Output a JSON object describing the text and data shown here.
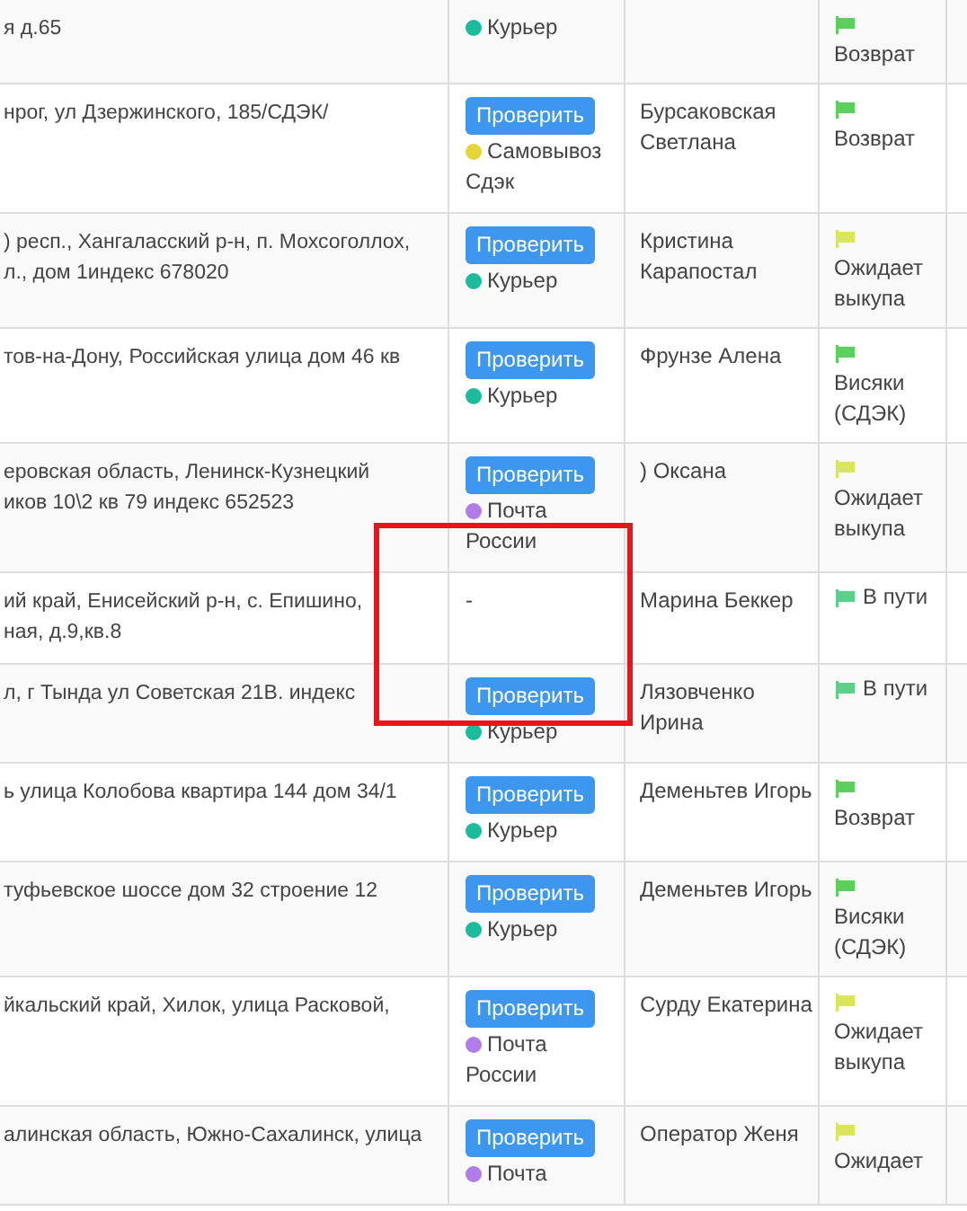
{
  "rows": [
    {
      "address": [
        "я д.65"
      ],
      "check_button": null,
      "delivery": {
        "label": "Курьер",
        "color": "#1abc9c"
      },
      "recipient": null,
      "status": {
        "label": "Возврат",
        "color": "#5ccf5c"
      }
    },
    {
      "address": [
        "нрог, ул Дзержинского, 185/СДЭК/"
      ],
      "check_button": "Проверить",
      "delivery": {
        "label": "Самовывоз Сдэк",
        "color": "#e6d536"
      },
      "recipient": "Бурсаковская Светлана",
      "status": {
        "label": "Возврат",
        "color": "#5ccf5c"
      }
    },
    {
      "address": [
        ") респ., Хангаласский р-н, п. Мохсоголлох,",
        "л., дом 1индекс 678020"
      ],
      "check_button": "Проверить",
      "delivery": {
        "label": "Курьер",
        "color": "#1abc9c"
      },
      "recipient": "Кристина Карапостал",
      "status": {
        "label": "Ожидает выкупа",
        "color": "#d9e65a"
      }
    },
    {
      "address": [
        "тов-на-Дону, Российская улица дом 46 кв"
      ],
      "check_button": "Проверить",
      "delivery": {
        "label": "Курьер",
        "color": "#1abc9c"
      },
      "recipient": "Фрунзе Алена",
      "status": {
        "label": "Висяки (СДЭК)",
        "color": "#5ccf5c"
      }
    },
    {
      "address": [
        "еровская область, Ленинск-Кузнецкий",
        "иков 10\\2 кв 79 индекс 652523"
      ],
      "check_button": "Проверить",
      "delivery": {
        "label": "Почта России",
        "color": "#b07ce8"
      },
      "recipient": ") Оксана",
      "status": {
        "label": "Ожидает выкупа",
        "color": "#d9e65a"
      }
    },
    {
      "address": [
        "ий край, Енисейский р-н, с. Епишино,",
        "ная, д.9,кв.8"
      ],
      "check_button": null,
      "delivery": {
        "label": "-"
      },
      "recipient": "Марина Беккер",
      "status": {
        "label": "В пути",
        "color": "#5ccf8a"
      }
    },
    {
      "address": [
        "л, г Тында ул Советская 21В. индекс"
      ],
      "check_button": "Проверить",
      "delivery": {
        "label": "Курьер",
        "color": "#1abc9c"
      },
      "recipient": "Лязовченко Ирина",
      "status": {
        "label": "В пути",
        "color": "#5ccf8a"
      }
    },
    {
      "address": [
        "ь улица Колобова квартира 144 дом 34/1"
      ],
      "check_button": "Проверить",
      "delivery": {
        "label": "Курьер",
        "color": "#1abc9c"
      },
      "recipient": "Деменьтев Игорь",
      "status": {
        "label": "Возврат",
        "color": "#5ccf5c"
      }
    },
    {
      "address": [
        "туфьевское шоссе дом 32 строение 12"
      ],
      "check_button": "Проверить",
      "delivery": {
        "label": "Курьер",
        "color": "#1abc9c"
      },
      "recipient": "Деменьтев Игорь",
      "status": {
        "label": "Висяки (СДЭК)",
        "color": "#5ccf5c"
      }
    },
    {
      "address": [
        "йкальский край, Хилок, улица Расковой,"
      ],
      "check_button": "Проверить",
      "delivery": {
        "label": "Почта России",
        "color": "#b07ce8"
      },
      "recipient": "Сурду Екатерина",
      "status": {
        "label": "Ожидает выкупа",
        "color": "#d9e65a"
      }
    },
    {
      "address": [
        "алинская область, Южно-Сахалинск, улица"
      ],
      "check_button": "Проверить",
      "delivery": {
        "label": "Почта",
        "color": "#b07ce8"
      },
      "recipient": "Оператор Женя",
      "status": {
        "label": "Ожидает",
        "color": "#d9e65a"
      }
    }
  ]
}
